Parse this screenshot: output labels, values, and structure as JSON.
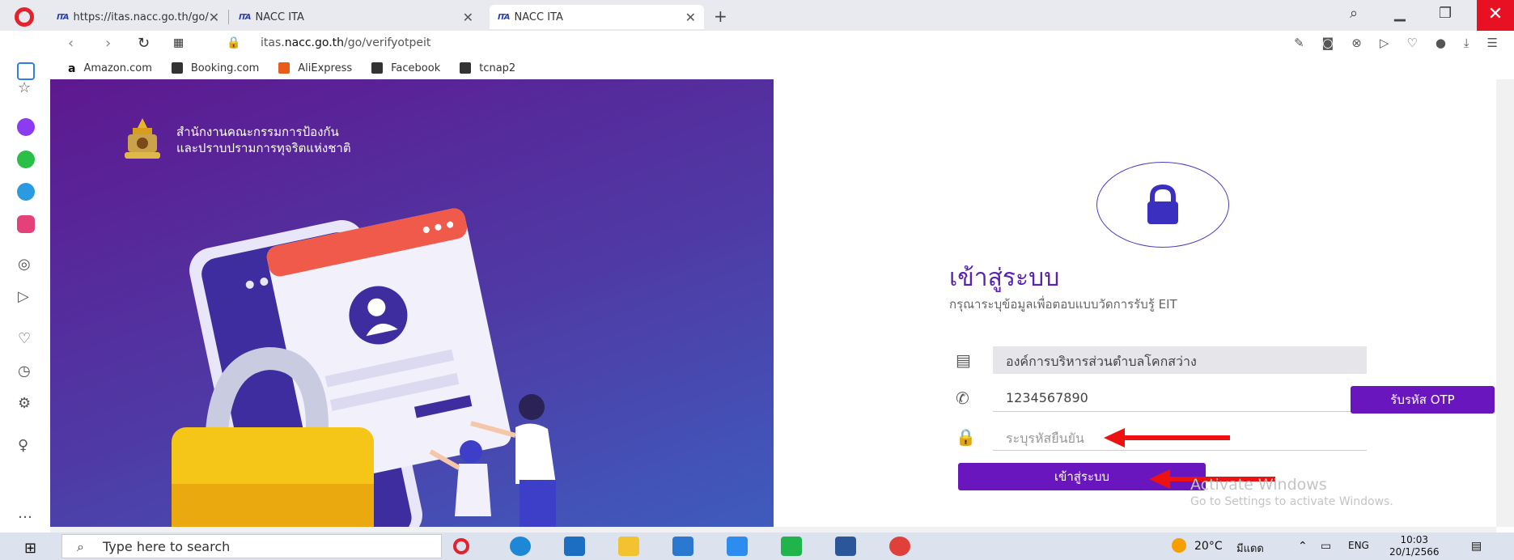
{
  "browser": {
    "tabs": [
      {
        "label": "https://itas.nacc.go.th/go/",
        "icon": "ITA"
      },
      {
        "label": "NACC ITA",
        "icon": "ITA"
      },
      {
        "label": "NACC ITA",
        "icon": "ITA",
        "active": true
      }
    ],
    "new_tab": "+",
    "url_host": "itas.",
    "url_domain": "nacc.go.th",
    "url_path": "/go/verifyotpeit",
    "bookmarks": [
      {
        "label": "Amazon.com",
        "icon": "amazon-icon"
      },
      {
        "label": "Booking.com",
        "icon": "folder-icon"
      },
      {
        "label": "AliExpress",
        "icon": "aliexpress-icon"
      },
      {
        "label": "Facebook",
        "icon": "folder-icon"
      },
      {
        "label": "tcnap2",
        "icon": "folder-icon"
      }
    ],
    "win_close": "✕"
  },
  "left_panel": {
    "org_line1": "สำนักงานคณะกรรมการป้องกัน",
    "org_line2": "และปราบปรามการทุจริตแห่งชาติ"
  },
  "login": {
    "title": "เข้าสู่ระบบ",
    "subtitle": "กรุณาระบุข้อมูลเพื่อตอบแบบวัดการรับรู้ EIT",
    "org_value": "องค์การบริหารส่วนตำบลโคกสว่าง",
    "phone_value": "1234567890",
    "code_placeholder": "ระบุรหัสยืนยัน",
    "otp_button": "รับรหัส OTP",
    "login_button": "เข้าสู่ระบบ"
  },
  "watermark": {
    "line1": "Activate Windows",
    "line2": "Go to Settings to activate Windows."
  },
  "taskbar": {
    "search_placeholder": "Type here to search",
    "weather": "20°C",
    "weather_desc": "มีแดด",
    "lang": "ENG",
    "time": "10:03",
    "date": "20/1/2566"
  },
  "colors": {
    "accent": "#6a16bf",
    "arrow": "#e11111",
    "panel_top": "#5e1890",
    "panel_bottom": "#3e5cbd"
  }
}
